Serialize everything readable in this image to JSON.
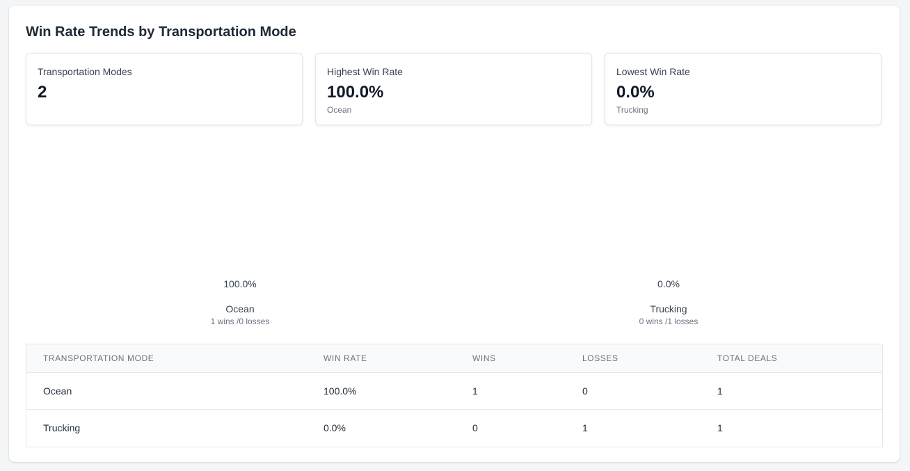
{
  "title": "Win Rate Trends by Transportation Mode",
  "stats": {
    "modes": {
      "label": "Transportation Modes",
      "value": "2"
    },
    "highest": {
      "label": "Highest Win Rate",
      "value": "100.0%",
      "sub": "Ocean"
    },
    "lowest": {
      "label": "Lowest Win Rate",
      "value": "0.0%",
      "sub": "Trucking"
    }
  },
  "chart_data": {
    "type": "bar",
    "categories": [
      "Ocean",
      "Trucking"
    ],
    "values": [
      100.0,
      0.0
    ],
    "value_labels": [
      "100.0%",
      "0.0%"
    ],
    "sublabels": [
      "1 wins /0 losses",
      "0 wins /1 losses"
    ],
    "ylim": [
      0,
      100
    ],
    "bar_color": "#ffffff"
  },
  "table": {
    "headers": [
      "TRANSPORTATION MODE",
      "WIN RATE",
      "WINS",
      "LOSSES",
      "TOTAL DEALS"
    ],
    "rows": [
      [
        "Ocean",
        "100.0%",
        "1",
        "0",
        "1"
      ],
      [
        "Trucking",
        "0.0%",
        "0",
        "1",
        "1"
      ]
    ]
  }
}
